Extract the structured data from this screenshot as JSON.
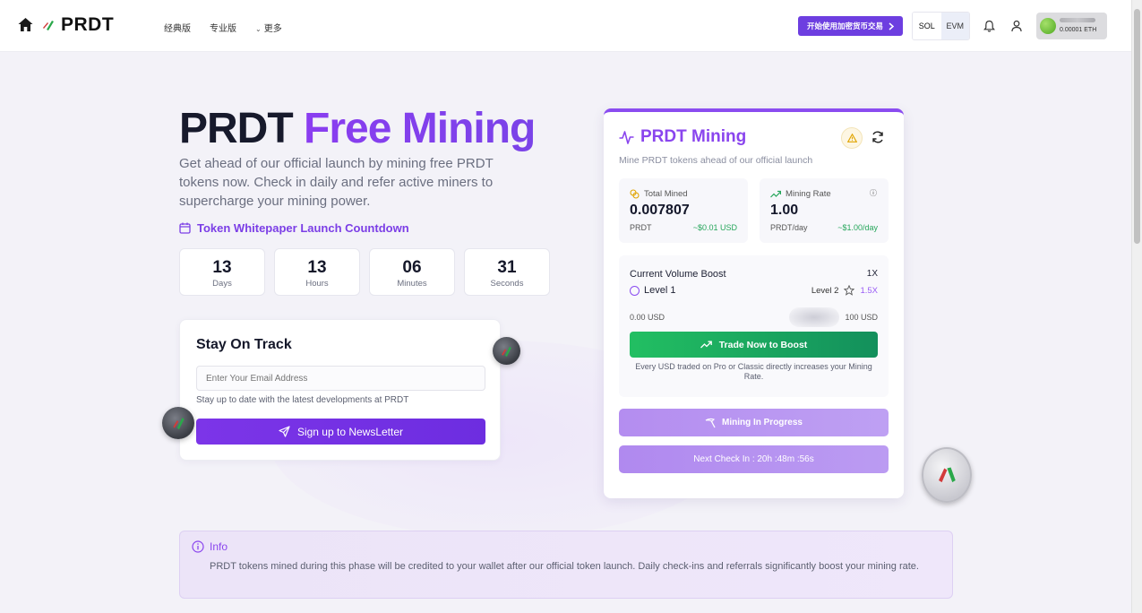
{
  "nav": {
    "logo_text": "PRDT",
    "menu": [
      "经典版",
      "专业版",
      "更多"
    ],
    "start_button": "开始使用加密货币交易",
    "chain_sol": "SOL",
    "chain_evm": "EVM",
    "wallet_balance": "0.00001 ETH"
  },
  "hero": {
    "title_part1": "PRDT",
    "title_part2": "Free Mining",
    "description": "Get ahead of our official launch by mining free PRDT tokens now. Check in daily and refer active miners to supercharge your mining power.",
    "countdown_label": "Token Whitepaper Launch Countdown",
    "countdown": [
      {
        "value": "13",
        "label": "Days"
      },
      {
        "value": "13",
        "label": "Hours"
      },
      {
        "value": "06",
        "label": "Minutes"
      },
      {
        "value": "31",
        "label": "Seconds"
      }
    ]
  },
  "newsletter": {
    "title": "Stay On Track",
    "email_placeholder": "Enter Your Email Address",
    "note": "Stay up to date with the latest developments at PRDT",
    "signup_button": "Sign up to NewsLetter"
  },
  "mining": {
    "title": "PRDT Mining",
    "subtitle": "Mine PRDT tokens ahead of our official launch",
    "total_mined_label": "Total Mined",
    "total_mined_value": "0.007807",
    "total_mined_unit": "PRDT",
    "total_mined_usd": "~$0.01 USD",
    "rate_label": "Mining Rate",
    "rate_value": "1.00",
    "rate_unit": "PRDT/day",
    "rate_usd": "~$1.00/day",
    "boost_label": "Current Volume Boost",
    "boost_multiplier": "1X",
    "level_current": "Level 1",
    "level_next": "Level 2",
    "level_next_multiplier": "1.5X",
    "range_low": "0.00 USD",
    "range_high": "100 USD",
    "trade_button": "Trade Now to Boost",
    "trade_hint": "Every USD traded on Pro or Classic directly increases your Mining Rate.",
    "mining_button": "Mining In Progress",
    "checkin_button": "Next Check In :  20h :48m :56s",
    "colors": {
      "accent": "#8a45ee",
      "green": "#22bf62"
    }
  },
  "info": {
    "title": "Info",
    "text": "PRDT tokens mined during this phase will be credited to your wallet after our official token launch. Daily check-ins and referrals significantly boost your mining rate."
  }
}
